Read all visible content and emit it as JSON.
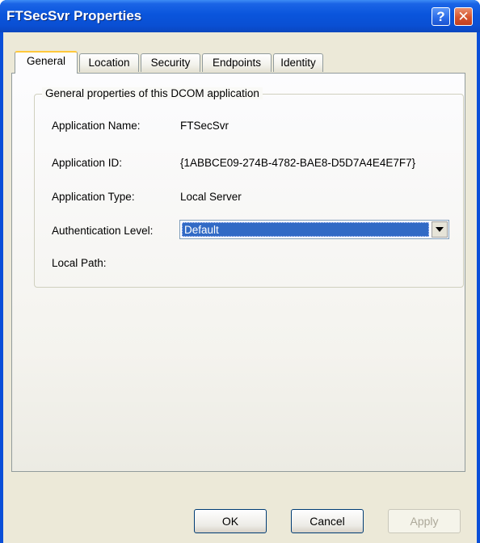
{
  "window": {
    "title": "FTSecSvr Properties",
    "help_glyph": "?",
    "close_glyph": "✕"
  },
  "tabs": [
    {
      "label": "General",
      "active": true
    },
    {
      "label": "Location",
      "active": false
    },
    {
      "label": "Security",
      "active": false
    },
    {
      "label": "Endpoints",
      "active": false
    },
    {
      "label": "Identity",
      "active": false
    }
  ],
  "general": {
    "group_caption": "General properties of this DCOM application",
    "fields": {
      "app_name_label": "Application Name:",
      "app_name_value": "FTSecSvr",
      "app_id_label": "Application ID:",
      "app_id_value": "{1ABBCE09-274B-4782-BAE8-D5D7A4E4E7F7}",
      "app_type_label": "Application Type:",
      "app_type_value": "Local Server",
      "auth_label": "Authentication Level:",
      "auth_value": "Default",
      "local_path_label": "Local Path:"
    }
  },
  "buttons": {
    "ok": "OK",
    "cancel": "Cancel",
    "apply": "Apply"
  },
  "colors": {
    "titlebar": "#0a55dc",
    "client_bg": "#ece9d8",
    "selection": "#316ac5",
    "tab_highlight": "#ffc83c"
  }
}
